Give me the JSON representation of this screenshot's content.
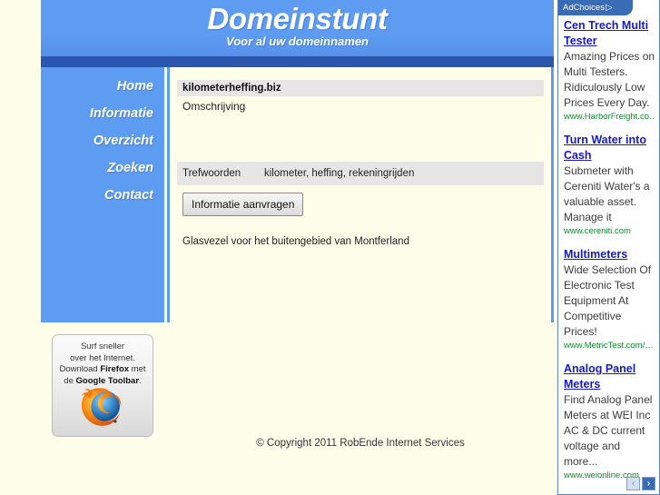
{
  "header": {
    "title": "Domeinstunt",
    "tagline": "Voor al uw domeinnamen"
  },
  "nav": {
    "items": [
      {
        "label": "Home"
      },
      {
        "label": "Informatie"
      },
      {
        "label": "Overzicht"
      },
      {
        "label": "Zoeken"
      },
      {
        "label": "Contact"
      }
    ]
  },
  "content": {
    "domain_name": "kilometerheffing.biz",
    "description_label": "Omschrijving",
    "keywords_label": "Trefwoorden",
    "keywords_value": "kilometer, heffing, rekeningrijden",
    "request_button": "Informatie aanvragen",
    "footer_note": "Glasvezel voor het buitengebied van Montferland"
  },
  "firefox_banner": {
    "line1": "Surf sneller",
    "line2": "over het Internet.",
    "line3_pre": "Download ",
    "line3_bold": "Firefox",
    "line3_post": " met",
    "line4_pre": "de ",
    "line4_bold": "Google Toolbar",
    "line4_post": ".",
    "logo": "firefox-logo"
  },
  "copyright": "© Copyright 2011 RobEnde Internet Services",
  "ads": {
    "adchoices_label": "AdChoices",
    "adchoices_icon": "▷",
    "prev_label": "‹",
    "next_label": "›",
    "units": [
      {
        "title": "Cen Trech Multi Tester",
        "body": "Amazing Prices on Multi Testers. Ridiculously Low Prices Every Day.",
        "url": "www.HarborFreight.co…"
      },
      {
        "title": "Turn Water into Cash",
        "body": "Submeter with Cereniti Water's a valuable asset. Manage it",
        "url": "www.cereniti.com"
      },
      {
        "title": "Multimeters",
        "body": "Wide Selection Of Electronic Test Equipment At Competitive Prices!",
        "url": "www.MetricTest.com/…"
      },
      {
        "title": "Analog Panel Meters",
        "body": "Find Analog Panel Meters at WEI Inc AC & DC current voltage and more...",
        "url": "www.weionline.com"
      }
    ]
  },
  "colors": {
    "page_background": "#fdfdea",
    "header_blue": "#5e9cf2",
    "header_dark_band": "#2a57ad",
    "ad_link_blue": "#1718c9",
    "ad_url_green": "#0f8a2e",
    "band_gray": "#e6e6e6"
  }
}
